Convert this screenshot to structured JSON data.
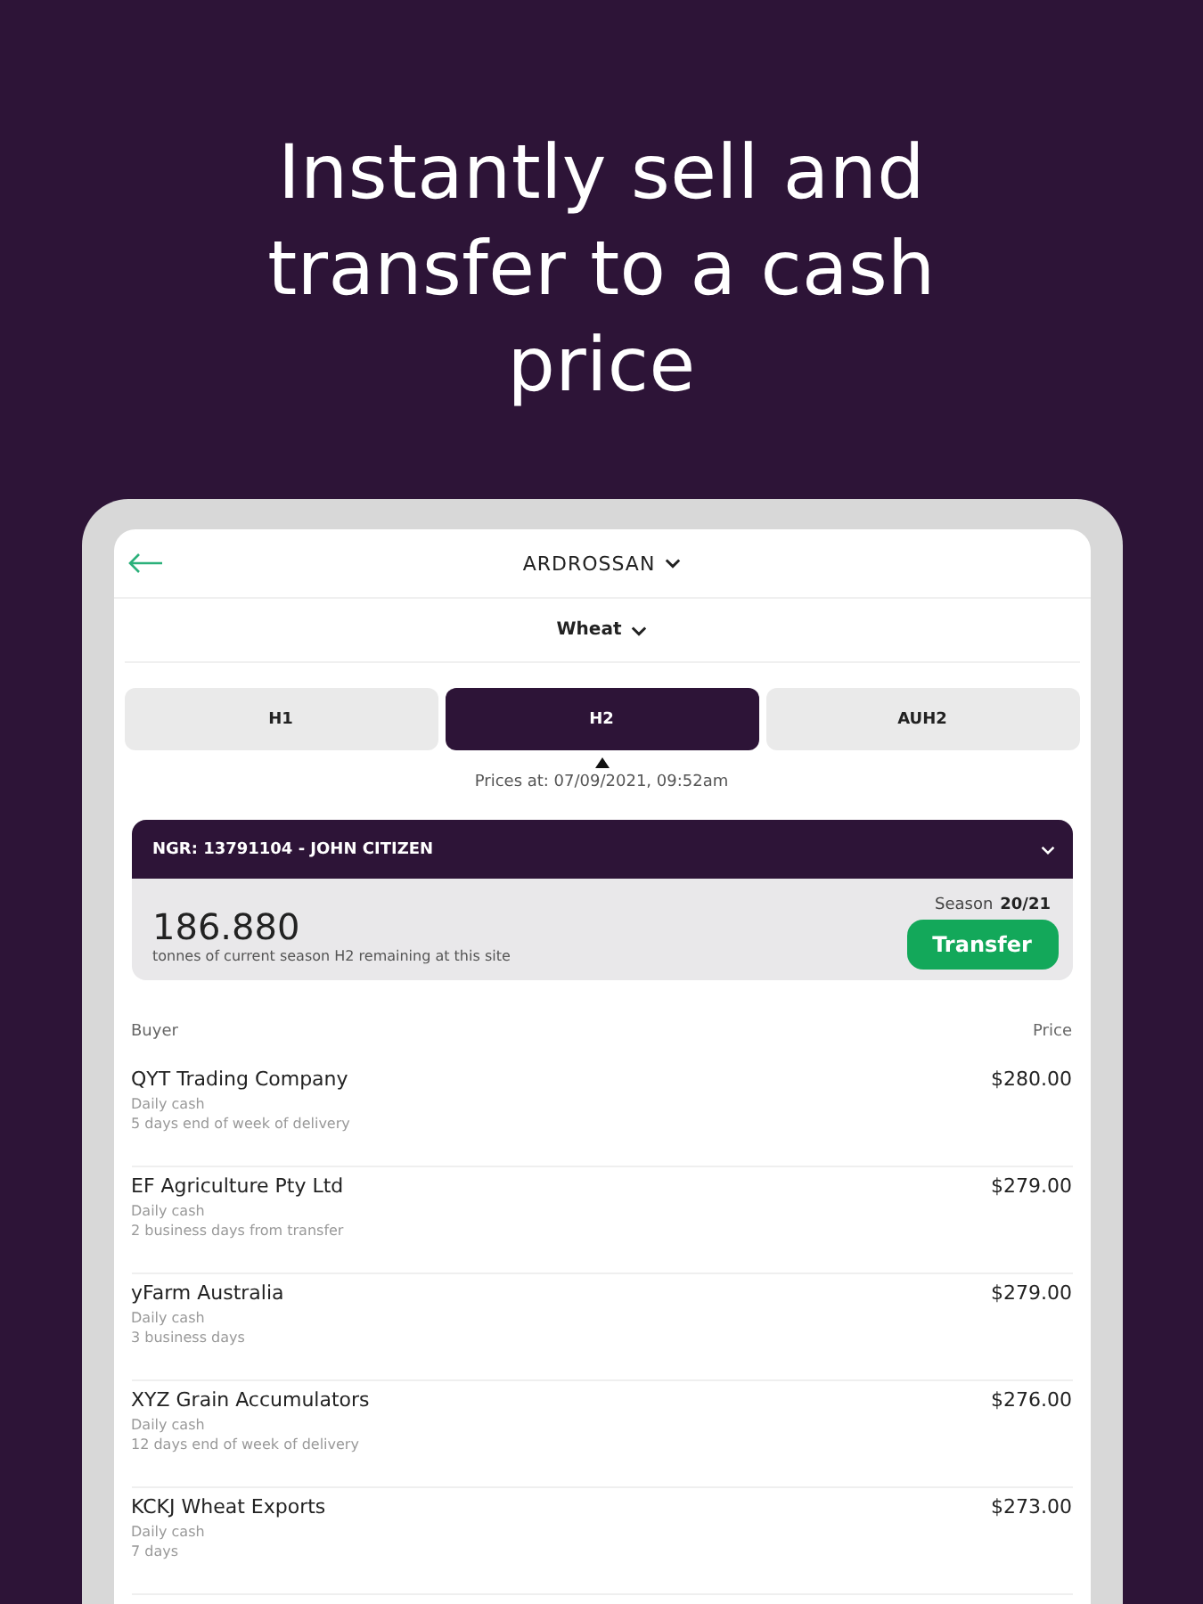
{
  "headline": "Instantly sell and transfer to a cash price",
  "header": {
    "site": "ARDROSSAN",
    "commodity": "Wheat"
  },
  "tabs": [
    {
      "label": "H1",
      "selected": false
    },
    {
      "label": "H2",
      "selected": true
    },
    {
      "label": "AUH2",
      "selected": false
    }
  ],
  "prices_at": "Prices at: 07/09/2021, 09:52am",
  "account": {
    "title": "NGR: 13791104 - JOHN CITIZEN",
    "tonnes": "186.880",
    "tonnes_caption": "tonnes of current season H2 remaining at this site",
    "season_label": "Season",
    "season": "20/21",
    "button": "Transfer"
  },
  "table": {
    "columns": [
      "Buyer",
      "Price"
    ],
    "rows": [
      {
        "buyer": "QYT Trading Company",
        "terms": [
          "Daily cash",
          "5 days end of week of delivery"
        ],
        "price": "$280.00"
      },
      {
        "buyer": "EF Agriculture Pty Ltd",
        "terms": [
          "Daily cash",
          "2 business days from transfer"
        ],
        "price": "$279.00"
      },
      {
        "buyer": "yFarm Australia",
        "terms": [
          "Daily cash",
          "3 business days"
        ],
        "price": "$279.00"
      },
      {
        "buyer": "XYZ Grain Accumulators",
        "terms": [
          "Daily cash",
          "12 days end of week of delivery"
        ],
        "price": "$276.00"
      },
      {
        "buyer": "KCKJ Wheat Exports",
        "terms": [
          "Daily cash",
          "7 days"
        ],
        "price": "$273.00"
      }
    ]
  }
}
